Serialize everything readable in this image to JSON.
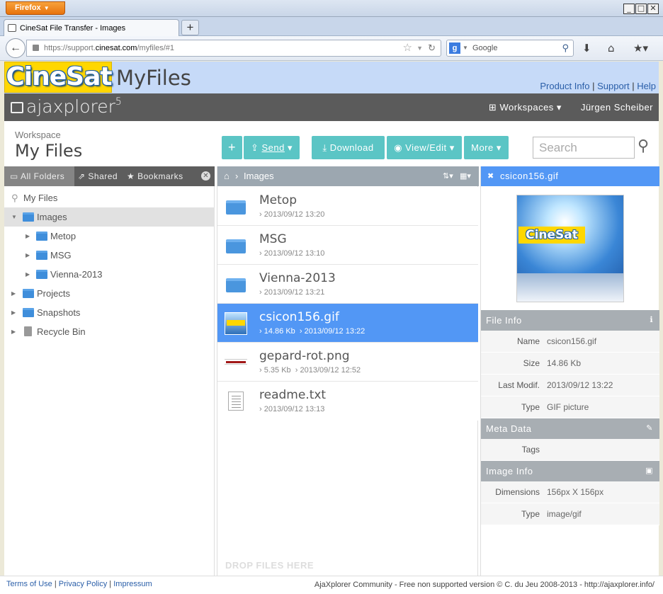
{
  "browser": {
    "menu_button": "Firefox",
    "tab_title": "CineSat File Transfer - Images",
    "url_prefix": "https://support.",
    "url_domain": "cinesat.com",
    "url_path": "/myfiles/#1",
    "search_engine_placeholder": "Google"
  },
  "header": {
    "logo": "CineSat",
    "title": "MyFiles",
    "links": [
      "Product Info",
      "Support",
      "Help"
    ]
  },
  "ajx": {
    "brand": "ajaxplorer",
    "version": "5",
    "workspaces": "Workspaces",
    "user": "Jürgen Scheiber"
  },
  "workspace": {
    "label": "Workspace",
    "name": "My Files"
  },
  "toolbar": {
    "send": "Send",
    "download": "Download",
    "view_edit": "View/Edit",
    "more": "More",
    "search_placeholder": "Search"
  },
  "left_tabs": [
    "All Folders",
    "Shared",
    "Bookmarks"
  ],
  "tree": [
    {
      "label": "My Files"
    },
    {
      "label": "Images"
    },
    {
      "label": "Metop"
    },
    {
      "label": "MSG"
    },
    {
      "label": "Vienna-2013"
    },
    {
      "label": "Projects"
    },
    {
      "label": "Snapshots"
    },
    {
      "label": "Recycle Bin"
    }
  ],
  "breadcrumb": "Images",
  "files": [
    {
      "name": "Metop",
      "meta": "2013/09/12 13:20"
    },
    {
      "name": "MSG",
      "meta": "2013/09/12 13:10"
    },
    {
      "name": "Vienna-2013",
      "meta": "2013/09/12 13:21"
    },
    {
      "name": "csicon156.gif",
      "size": "14.86 Kb",
      "meta": "2013/09/12 13:22"
    },
    {
      "name": "gepard-rot.png",
      "size": "5.35 Kb",
      "meta": "2013/09/12 12:52"
    },
    {
      "name": "readme.txt",
      "meta": "2013/09/12 13:13"
    }
  ],
  "drop_hint": "DROP FILES HERE",
  "right": {
    "title": "csicon156.gif",
    "preview_logo": "CineSat",
    "file_info_title": "File Info",
    "file_info": [
      {
        "k": "Name",
        "v": "csicon156.gif"
      },
      {
        "k": "Size",
        "v": "14.86 Kb"
      },
      {
        "k": "Last Modif.",
        "v": "2013/09/12 13:22"
      },
      {
        "k": "Type",
        "v": "GIF picture"
      }
    ],
    "meta_title": "Meta Data",
    "meta": [
      {
        "k": "Tags",
        "v": ""
      }
    ],
    "image_info_title": "Image Info",
    "image_info": [
      {
        "k": "Dimensions",
        "v": "156px X 156px"
      },
      {
        "k": "Type",
        "v": "image/gif"
      }
    ]
  },
  "footer": {
    "links": [
      "Terms of Use",
      "Privacy Policy",
      "Impressum"
    ],
    "right": "AjaXplorer Community - Free non supported version © C. du Jeu 2008-2013 - http://ajaxplorer.info/"
  }
}
